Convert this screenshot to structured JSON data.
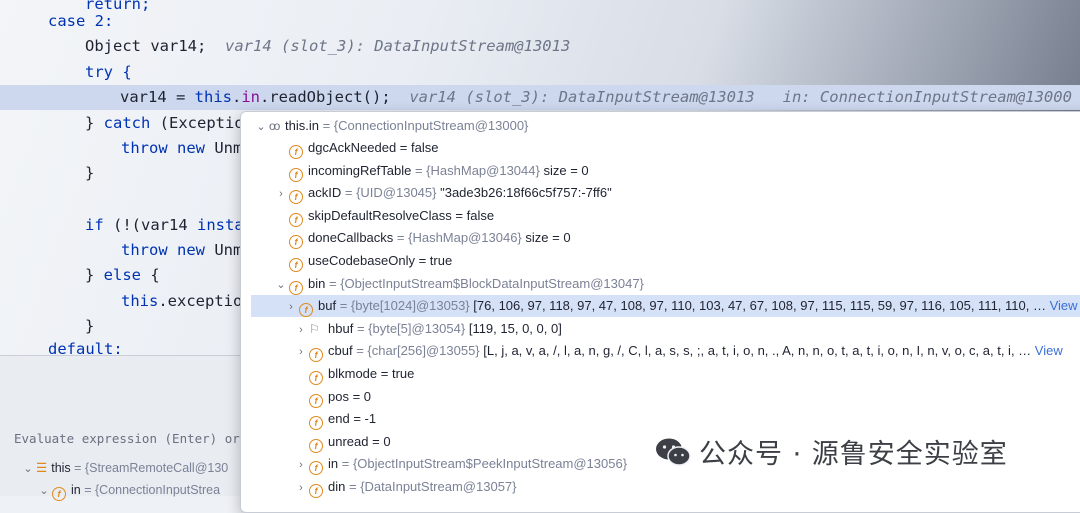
{
  "code": {
    "l0": "return;",
    "case2": "case 2:",
    "decl_type": "Object",
    "decl_name": " var14;",
    "decl_hint": "var14 (slot_3): DataInputStream@13013",
    "try": "try {",
    "assign_lhs": "var14 = ",
    "assign_this": "this",
    "assign_dot": ".",
    "assign_in": "in",
    "assign_call": ".readObject();",
    "assign_hint1": "var14 (slot_3): DataInputStream@13013",
    "assign_hint2": "in: ConnectionInputStream@13000",
    "catch_open": "} ",
    "catch_kw": "catch",
    "catch_rest": " (Exceptio",
    "throw1_kw": "throw new",
    "throw1_rest": " Unm",
    "close1": "}",
    "if_kw": "if",
    "if_rest": " (!(var14 ",
    "if_insta": "insta",
    "throw2_kw": "throw new",
    "throw2_rest": " Unm",
    "else_open": "} ",
    "else_kw": "else",
    "else_rest": " {",
    "this_exc_kw": "this",
    "this_exc_rest": ".exceptio",
    "close2": "}",
    "default": "default:"
  },
  "eval": {
    "label": "Evaluate expression (Enter) or",
    "row1_name": "this",
    "row1_ref": "= {StreamRemoteCall@130",
    "row2_name": "in",
    "row2_ref": "= {ConnectionInputStrea"
  },
  "popup": {
    "root_name": "this.in",
    "root_ref": "= {ConnectionInputStream@13000}",
    "rows": [
      {
        "name": "dgcAckNeeded",
        "ref": "",
        "val": "= false"
      },
      {
        "name": "incomingRefTable",
        "ref": "= {HashMap@13044}",
        "val": "size = 0"
      },
      {
        "name": "ackID",
        "ref": "= {UID@13045}",
        "val": "\"3ade3b26:18f66c5f757:-7ff6\""
      },
      {
        "name": "skipDefaultResolveClass",
        "ref": "",
        "val": "= false"
      },
      {
        "name": "doneCallbacks",
        "ref": "= {HashMap@13046}",
        "val": "size = 0"
      },
      {
        "name": "useCodebaseOnly",
        "ref": "",
        "val": "= true"
      },
      {
        "name": "bin",
        "ref": "= {ObjectInputStream$BlockDataInputStream@13047}",
        "val": ""
      }
    ],
    "children": [
      {
        "name": "buf",
        "ref": "= {byte[1024]@13053}",
        "val": "[76, 106, 97, 118, 97, 47, 108, 97, 110, 103, 47, 67, 108, 97, 115, 115, 59, 97, 116, 105, 111, 110, …",
        "link": "View"
      },
      {
        "name": "hbuf",
        "ref": "= {byte[5]@13054}",
        "val": "[119, 15, 0, 0, 0]",
        "link": ""
      },
      {
        "name": "cbuf",
        "ref": "= {char[256]@13055}",
        "val": "[L, j, a, v, a, /, l, a, n, g, /, C, l, a, s, s, ;, a, t, i, o, n, ., A, n, n, o, t, a, t, i, o, n, I, n, v, o, c, a, t, i, …",
        "link": "View"
      },
      {
        "name": "blkmode",
        "ref": "",
        "val": "= true",
        "link": ""
      },
      {
        "name": "pos",
        "ref": "",
        "val": "= 0",
        "link": ""
      },
      {
        "name": "end",
        "ref": "",
        "val": "= -1",
        "link": ""
      },
      {
        "name": "unread",
        "ref": "",
        "val": "= 0",
        "link": ""
      },
      {
        "name": "in",
        "ref": "= {ObjectInputStream$PeekInputStream@13056}",
        "val": "",
        "link": ""
      },
      {
        "name": "din",
        "ref": "= {DataInputStream@13057}",
        "val": "",
        "link": ""
      }
    ]
  },
  "watermark": {
    "text": "公众号 · 源鲁安全实验室",
    "icon": "wechat-icon"
  },
  "colors": {
    "keyword": "#0033b3",
    "highlight": "#cdd8ee",
    "selection": "#d5e1f7",
    "field_icon": "#e08a1e"
  }
}
